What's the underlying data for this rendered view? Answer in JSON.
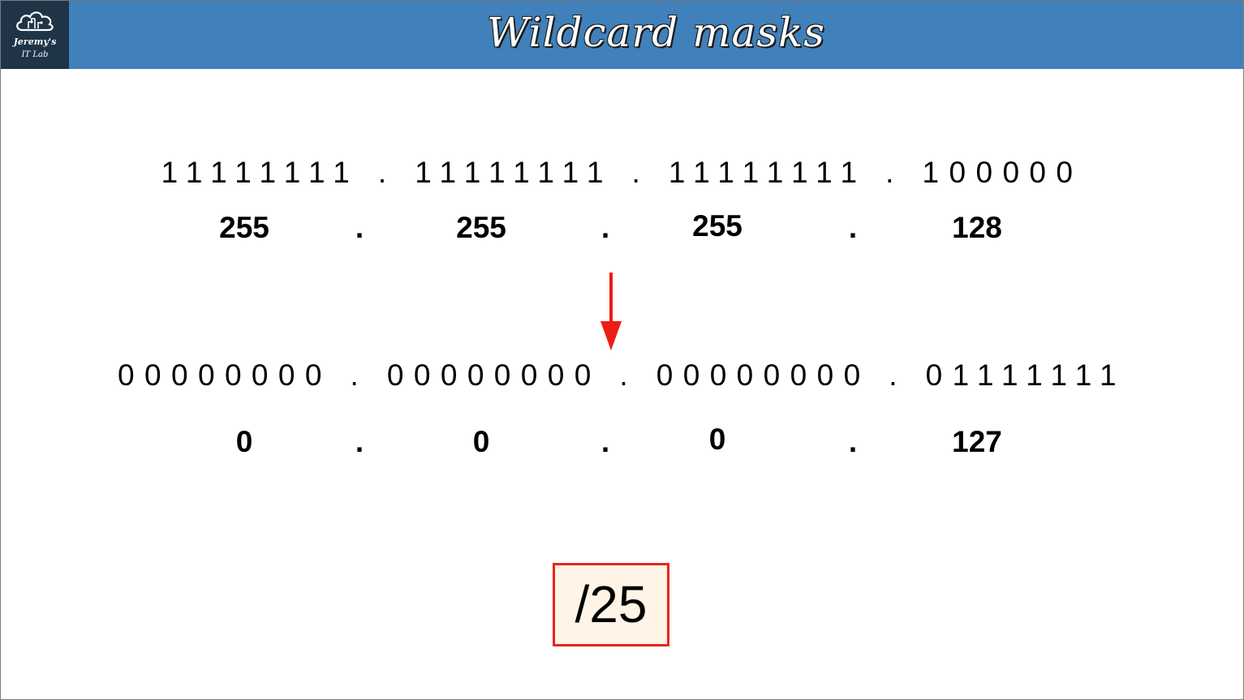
{
  "header": {
    "title": "Wildcard masks",
    "logo_line1": "Jeremy's",
    "logo_line2": "IT Lab",
    "logo_icon": "cloud-circuit-icon",
    "bg_color": "#4080bb",
    "logo_bg_color": "#1f3447"
  },
  "subnet_mask": {
    "binary": "11111111.11111111.11111111.100000",
    "octets": [
      "255",
      ".",
      "255",
      ".",
      "255",
      ".",
      "128"
    ]
  },
  "arrow": {
    "icon": "down-arrow-icon",
    "color": "#ee1c14"
  },
  "wildcard_mask": {
    "binary": "00000000.00000000.00000000.01111111",
    "octets": [
      "0",
      ".",
      "0",
      ".",
      "0",
      ".",
      "127"
    ]
  },
  "prefix": {
    "label": "/25",
    "border_color": "#e8261f"
  }
}
